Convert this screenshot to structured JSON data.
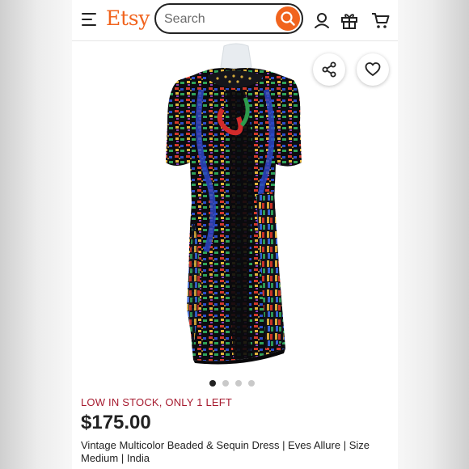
{
  "header": {
    "logo": "Etsy",
    "search_placeholder": "Search"
  },
  "icons": {
    "menu": "menu-icon",
    "search": "search-icon",
    "account": "user-icon",
    "gift": "gift-icon",
    "cart": "cart-icon",
    "share": "share-icon",
    "favorite": "heart-icon"
  },
  "colors": {
    "brand": "#f1641e",
    "stock_text": "#a61a2e",
    "text": "#222222"
  },
  "carousel": {
    "total_images": 4,
    "active_index": 0
  },
  "listing": {
    "stock_notice": "LOW IN STOCK, ONLY 1 LEFT",
    "price": "$175.00",
    "title": "Vintage Multicolor Beaded & Sequin Dress | Eves Allure | Size Medium | India"
  }
}
